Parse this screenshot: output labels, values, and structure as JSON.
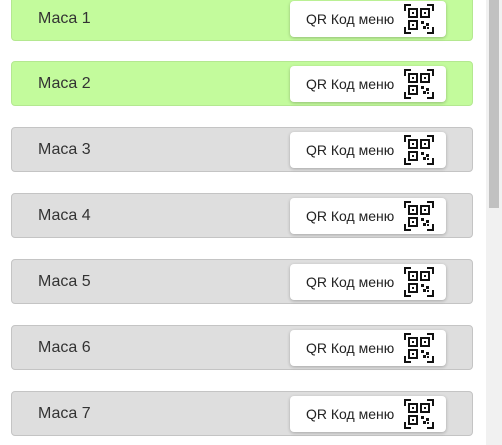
{
  "tables": [
    {
      "name": "Маса 1",
      "status": "active"
    },
    {
      "name": "Маса 2",
      "status": "active"
    },
    {
      "name": "Маса 3",
      "status": "inactive"
    },
    {
      "name": "Маса 4",
      "status": "inactive"
    },
    {
      "name": "Маса 5",
      "status": "inactive"
    },
    {
      "name": "Маса 6",
      "status": "inactive"
    },
    {
      "name": "Маса 7",
      "status": "inactive"
    }
  ],
  "qr_button_label": "QR Код меню",
  "icons": {
    "qr": "qr-code-icon"
  },
  "colors": {
    "active": "#c3fb9c",
    "inactive": "#dedede"
  }
}
